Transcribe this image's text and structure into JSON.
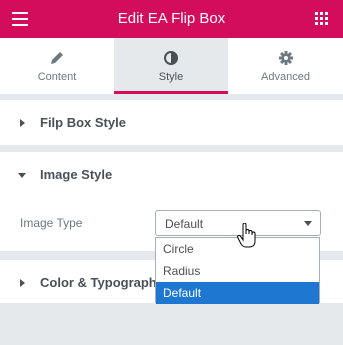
{
  "header": {
    "title": "Edit EA Flip Box",
    "menu_icon": "hamburger-icon",
    "apps_icon": "grid-icon"
  },
  "tabs": [
    {
      "label": "Content",
      "icon": "pencil-icon",
      "active": false
    },
    {
      "label": "Style",
      "icon": "contrast-icon",
      "active": true
    },
    {
      "label": "Advanced",
      "icon": "gear-icon",
      "active": false
    }
  ],
  "sections": {
    "flipbox": {
      "title": "Filp Box Style"
    },
    "image": {
      "title": "Image Style"
    },
    "color": {
      "title": "Color & Typography"
    }
  },
  "image_type": {
    "label": "Image Type",
    "value": "Default",
    "options": [
      "Circle",
      "Radius",
      "Default"
    ]
  },
  "colors": {
    "accent": "#d30c5c",
    "selection": "#1e78d1",
    "panel_bg": "#e6e9ec"
  }
}
